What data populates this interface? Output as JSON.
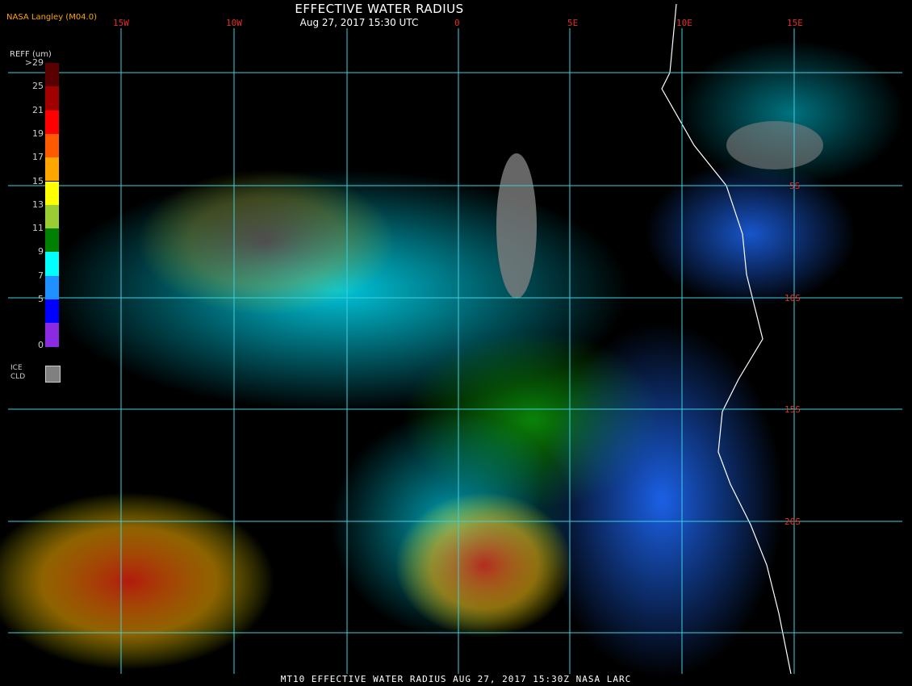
{
  "header": {
    "title": "EFFECTIVE WATER RADIUS",
    "subtitle": "Aug 27, 2017 15:30 UTC",
    "credit": "NASA Langley (M04.0)"
  },
  "footer": {
    "caption": "MT10  EFFECTIVE WATER RADIUS   AUG 27, 2017 15:30Z   NASA LARC"
  },
  "grid": {
    "lon_labels": [
      "15W",
      "10W",
      "0",
      "5E",
      "10E",
      "15E"
    ],
    "lat_labels": [
      "5S",
      "10S",
      "15S",
      "20S"
    ]
  },
  "legend": {
    "title": "REFF (um)",
    "ticks": [
      ">29",
      "25",
      "21",
      "19",
      "17",
      "15",
      "13",
      "11",
      "9",
      "7",
      "5",
      "0"
    ],
    "colors": [
      "#5a0000",
      "#a00000",
      "#ff0000",
      "#ff5a00",
      "#ffa500",
      "#ffff00",
      "#9acd32",
      "#008000",
      "#00ffff",
      "#1e90ff",
      "#0000ff",
      "#8a2be2"
    ],
    "ice_label_1": "ICE",
    "ice_label_2": "CLD",
    "ice_color": "#808080"
  }
}
